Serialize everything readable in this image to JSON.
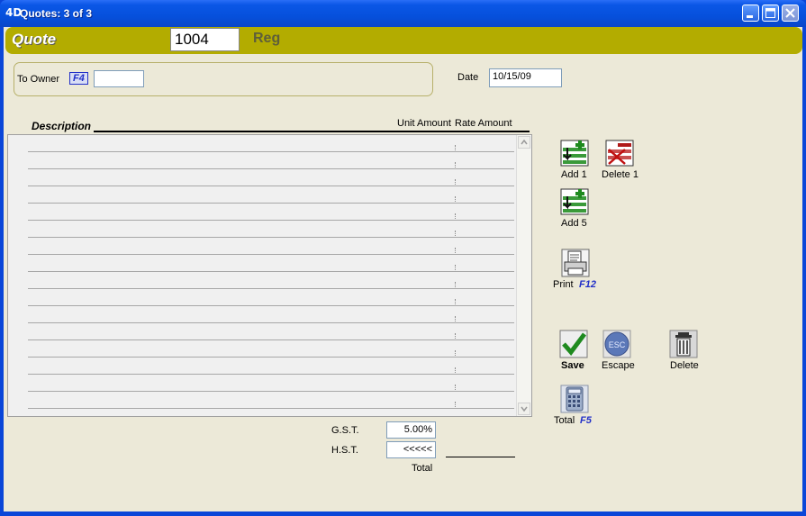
{
  "window": {
    "logo": "4D",
    "title": "Quotes: 3 of 3"
  },
  "banner": {
    "title": "Quote",
    "quote_number": "1004",
    "status": "Reg"
  },
  "owner": {
    "label": "To Owner",
    "fkey": "F4",
    "value": ""
  },
  "date": {
    "label": "Date",
    "value": "10/15/09"
  },
  "table": {
    "description_header": "Description",
    "unit_amount_header": "Unit Amount",
    "rate_amount_header": "Rate Amount",
    "row_count": 16
  },
  "tax": {
    "gst_label": "G.S.T.",
    "gst_value": "5.00%",
    "hst_label": "H.S.T.",
    "hst_value": "<<<<<",
    "total_label": "Total"
  },
  "tools": {
    "add1": "Add 1",
    "delete1": "Delete 1",
    "add5": "Add 5",
    "print": "Print",
    "print_fkey": "F12",
    "save": "Save",
    "escape": "Escape",
    "escape_icon_text": "ESC",
    "delete": "Delete",
    "total": "Total",
    "total_fkey": "F5"
  },
  "colors": {
    "banner": "#b3ac00",
    "fkey": "#2230c8",
    "titlebar": "#0650dc"
  }
}
